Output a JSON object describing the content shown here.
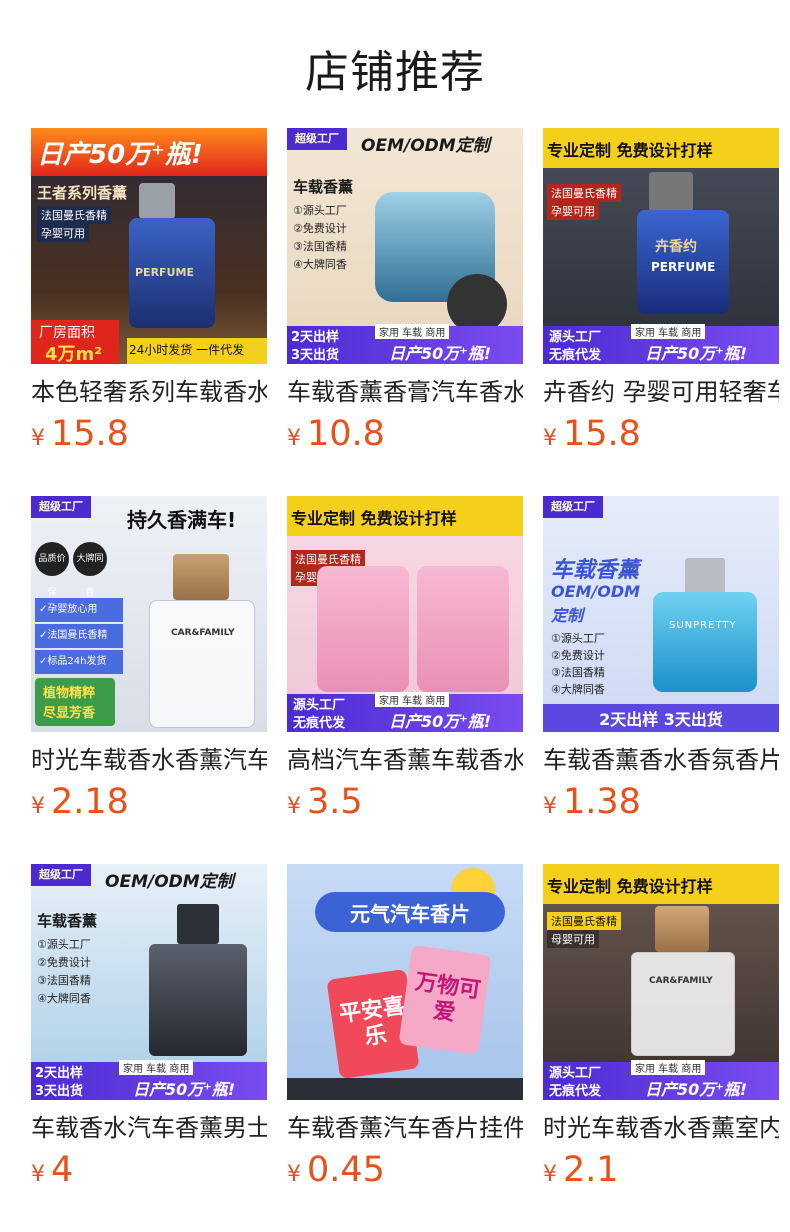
{
  "page": {
    "title": "店铺推荐"
  },
  "currency_symbol": "¥",
  "products": [
    {
      "name": "本色轻奢系列车载香水",
      "price": "15.8",
      "image_text": {
        "banner": "日产50万⁺瓶!",
        "series": "王者系列香薰",
        "line1": "法国曼氏香精",
        "line2": "孕婴可用",
        "brand": "PERFUME",
        "area_label": "厂房面积",
        "area_value": "4万m²",
        "footer": "24小时发货 一件代发"
      },
      "colors": {
        "bg": "#1d2b4c",
        "accent": "#e0261c",
        "bottle": "#2c51a8"
      }
    },
    {
      "name": "车载香薰香膏汽车香水",
      "price": "10.8",
      "image_text": {
        "badge": "超级工厂",
        "banner": "OEM/ODM定制",
        "head": "车载香薰",
        "items": [
          "①源头工厂",
          "②免费设计",
          "③法国香精",
          "④大牌同香"
        ],
        "left1": "2天出样",
        "left2": "3天出货",
        "scene": "家用 车载 商用",
        "daily": "日产50万⁺瓶!"
      },
      "colors": {
        "bg": "#efe3cf",
        "accent": "#4b2bd1",
        "bottle": "#5fa3c8"
      }
    },
    {
      "name": "卉香约 孕婴可用轻奢车载香水",
      "price": "15.8",
      "image_text": {
        "banner": "专业定制 免费设计打样",
        "line1": "法国曼氏香精",
        "line2": "孕婴可用",
        "brand_cn": "卉香约",
        "brand": "PERFUME",
        "left1": "源头工厂",
        "left2": "无痕代发",
        "scene": "家用 车载 商用",
        "daily": "日产50万⁺瓶!"
      },
      "colors": {
        "bg": "#3b3f4a",
        "accent": "#f4d01c",
        "bottle": "#2a4fb3"
      }
    },
    {
      "name": "时光车载香水香薰汽车摆件",
      "price": "2.18",
      "image_text": {
        "badge": "超级工厂",
        "banner": "持久香满车!",
        "seal1": "品质价保",
        "seal2": "大牌同香",
        "tags": [
          "✓孕婴放心用",
          "✓法国曼氏香精",
          "✓标品24h发货"
        ],
        "green1": "植物精粹",
        "green2": "尽显芳香",
        "label": "CAR&FAMILY"
      },
      "colors": {
        "bg": "#e9edf3",
        "accent": "#4b2bd1",
        "bottle": "#c9b08c"
      }
    },
    {
      "name": "高档汽车香薰车载香水",
      "price": "3.5",
      "image_text": {
        "banner": "专业定制 免费设计打样",
        "line1": "法国曼氏香精",
        "line2": "孕婴可用",
        "left1": "源头工厂",
        "left2": "无痕代发",
        "scene": "家用 车载 商用",
        "daily": "日产50万⁺瓶!"
      },
      "colors": {
        "bg": "#f6d3df",
        "accent": "#f4d01c",
        "bottle": "#f2a9c7"
      }
    },
    {
      "name": "车载香薰香水香氛香片",
      "price": "1.38",
      "image_text": {
        "badge": "超级工厂",
        "head": "车载香薰",
        "sub1": "OEM/ODM",
        "sub2": "定制",
        "items": [
          "①源头工厂",
          "②免费设计",
          "③法国香精",
          "④大牌同香"
        ],
        "footer": "2天出样 3天出货",
        "label": "SUNPRETTY"
      },
      "colors": {
        "bg": "#dfe6f7",
        "accent": "#3b55d6",
        "bottle": "#35b6e6"
      }
    },
    {
      "name": "车载香水汽车香薰男士",
      "price": "4",
      "image_text": {
        "badge": "超级工厂",
        "banner": "OEM/ODM定制",
        "head": "车载香薰",
        "items": [
          "①源头工厂",
          "②免费设计",
          "③法国香精",
          "④大牌同香"
        ],
        "left1": "2天出样",
        "left2": "3天出货",
        "scene": "家用 车载 商用",
        "daily": "日产50万⁺瓶!"
      },
      "colors": {
        "bg": "#cfe3f3",
        "accent": "#4b2bd1",
        "bottle": "#3a3f48"
      }
    },
    {
      "name": "车载香薰汽车香片挂件",
      "price": "0.45",
      "image_text": {
        "banner": "元气汽车香片",
        "card1": "平安喜乐",
        "card2": "万物可爱"
      },
      "colors": {
        "bg": "#bcd3f3",
        "accent": "#f6a9c6",
        "bottle": "#ff8a9e"
      }
    },
    {
      "name": "时光车载香水香薰室内",
      "price": "2.1",
      "image_text": {
        "banner": "专业定制 免费设计打样",
        "line1": "法国曼氏香精",
        "line2": "母婴可用",
        "label": "CAR&FAMILY",
        "left1": "源头工厂",
        "left2": "无痕代发",
        "scene": "家用 车载 商用",
        "daily": "日产50万⁺瓶!"
      },
      "colors": {
        "bg": "#5a4a44",
        "accent": "#f4d01c",
        "bottle": "#c99a6b"
      }
    }
  ]
}
